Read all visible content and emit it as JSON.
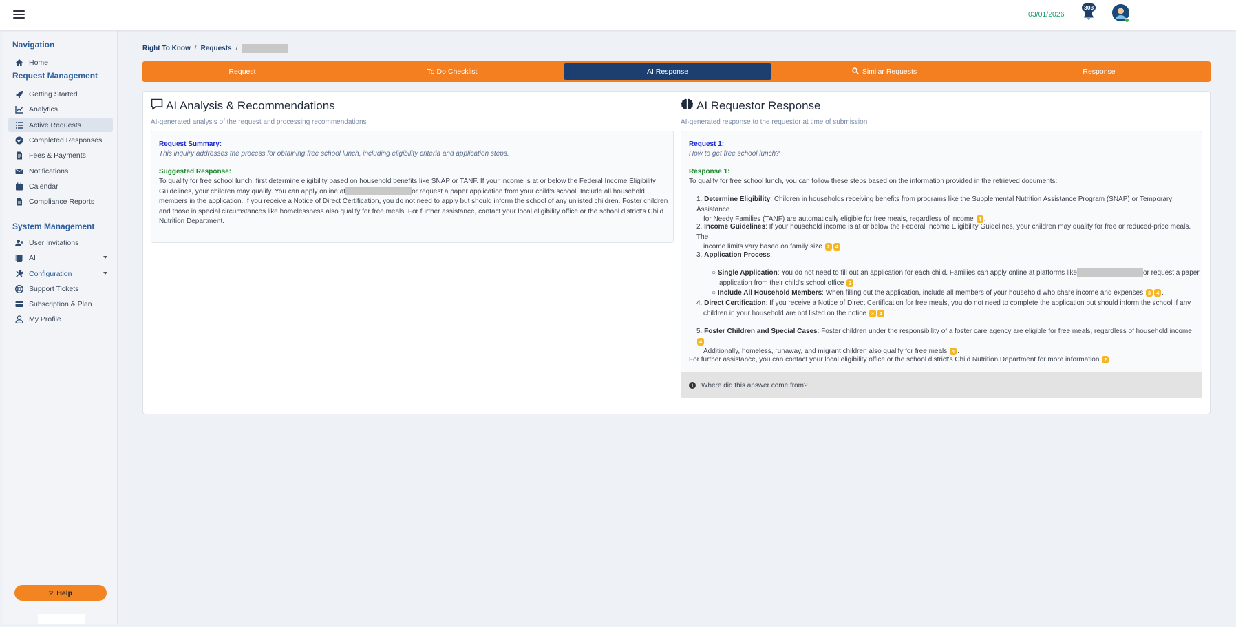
{
  "topbar": {
    "date": "03/01/2026",
    "notification_count": "303"
  },
  "sidebar": {
    "sections": [
      {
        "heading": "Navigation"
      },
      {
        "heading": "Request Management"
      },
      {
        "heading": "System Management"
      }
    ],
    "items": [
      {
        "label": "Home",
        "icon": "home-icon"
      },
      {
        "label": "Getting Started",
        "icon": "rocket-icon"
      },
      {
        "label": "Analytics",
        "icon": "chart-line-icon"
      },
      {
        "label": "Active Requests",
        "icon": "list-icon",
        "active": true
      },
      {
        "label": "Completed Responses",
        "icon": "check-circle-icon"
      },
      {
        "label": "Fees & Payments",
        "icon": "invoice-icon"
      },
      {
        "label": "Notifications",
        "icon": "envelope-icon"
      },
      {
        "label": "Calendar",
        "icon": "calendar-icon"
      },
      {
        "label": "Compliance Reports",
        "icon": "file-icon"
      },
      {
        "label": "User Invitations",
        "icon": "user-plus-icon"
      },
      {
        "label": "AI",
        "icon": "memory-icon"
      },
      {
        "label": "Configuration",
        "icon": "tools-icon"
      },
      {
        "label": "Support Tickets",
        "icon": "support-icon"
      },
      {
        "label": "Subscription & Plan",
        "icon": "credit-card-icon"
      },
      {
        "label": "My Profile",
        "icon": "user-icon"
      }
    ],
    "help_label": "Help"
  },
  "breadcrumb": {
    "items": [
      "Right To Know",
      "Requests"
    ]
  },
  "tabs": [
    {
      "label": "Request"
    },
    {
      "label": "To Do Checklist"
    },
    {
      "label": "AI Response",
      "active": true
    },
    {
      "label": "Similar Requests",
      "icon": "search-icon"
    },
    {
      "label": "Response"
    }
  ],
  "analysis": {
    "title": "AI Analysis & Recommendations",
    "subtitle": "AI-generated analysis of the request and processing recommendations",
    "summary_label": "Request Summary:",
    "summary_text": "This inquiry addresses the process for obtaining free school lunch, including eligibility criteria and application steps.",
    "suggested_label": "Suggested Response:",
    "suggested_line1": "To qualify for free school lunch, first determine eligibility based on household benefits like SNAP or TANF. If your income is at or below the Federal Income Eligibility",
    "suggested_line2a": "Guidelines, your children may qualify. You can apply online at",
    "suggested_line2b": "or request a paper application from your child's school. Include all household",
    "suggested_line3": "members in the application. If you receive a Notice of Direct Certification, you do not need to apply but should inform the school of any unlisted children. Foster children",
    "suggested_line4": "and those in special circumstances like homelessness also qualify for free meals. For further assistance, contact your local eligibility office or the school district's Child",
    "suggested_line5": "Nutrition Department."
  },
  "requestor": {
    "title": "AI Requestor Response",
    "subtitle": "AI-generated response to the requestor at time of submission",
    "request_label": "Request 1:",
    "request_text": "How to get free school lunch?",
    "response_label": "Response 1:",
    "intro": "To qualify for free school lunch, you can follow these steps based on the information provided in the retrieved documents:",
    "item1_title": "Determine Eligibility",
    "item1_line1": ": Children in households receiving benefits from programs like the Supplemental Nutrition Assistance Program (SNAP) or Temporary Assistance",
    "item1_line2": "for Needy Families (TANF) are automatically eligible for free meals, regardless of income",
    "item2_title": "Income Guidelines",
    "item2_line1": ": If your household income is at or below the Federal Income Eligibility Guidelines, your children may qualify for free or reduced-price meals. The",
    "item2_line2": "income limits vary based on family size",
    "item3_title": "Application Process",
    "sub1_title": "Single Application",
    "sub1_line1": ": You do not need to fill out an application for each child. Families can apply online at platforms like",
    "sub1_line1b": "or request a paper",
    "sub1_line2": "application from their child's school office",
    "sub2_title": "Include All Household Members",
    "sub2_line1": ": When filling out the application, include all members of your household who share income and expenses",
    "item4_title": "Direct Certification",
    "item4_line1": ": If you receive a Notice of Direct Certification for free meals, you do not need to complete the application but should inform the school if any",
    "item4_line2": "children in your household are not listed on the notice",
    "item5_title": "Foster Children and Special Cases",
    "item5_line1": ": Foster children under the responsibility of a foster care agency are eligible for free meals, regardless of household income",
    "item5_line2": "Additionally, homeless, runaway, and migrant children also qualify for free meals",
    "closing": "For further assistance, you can contact your local eligibility office or the school district's Child Nutrition Department for more information",
    "source_label": "Where did this answer come from?",
    "cites": {
      "c1": "4",
      "c2a": "2",
      "c2b": "4",
      "c3": "3",
      "c4a": "3",
      "c4b": "4",
      "c5a": "3",
      "c5b": "4",
      "c6a": "4",
      "c6b": "4",
      "c7": "2"
    }
  },
  "colors": {
    "accent_orange": "#f47f20",
    "nav_blue": "#1d3f70",
    "cite_yellow": "#f5b622"
  }
}
